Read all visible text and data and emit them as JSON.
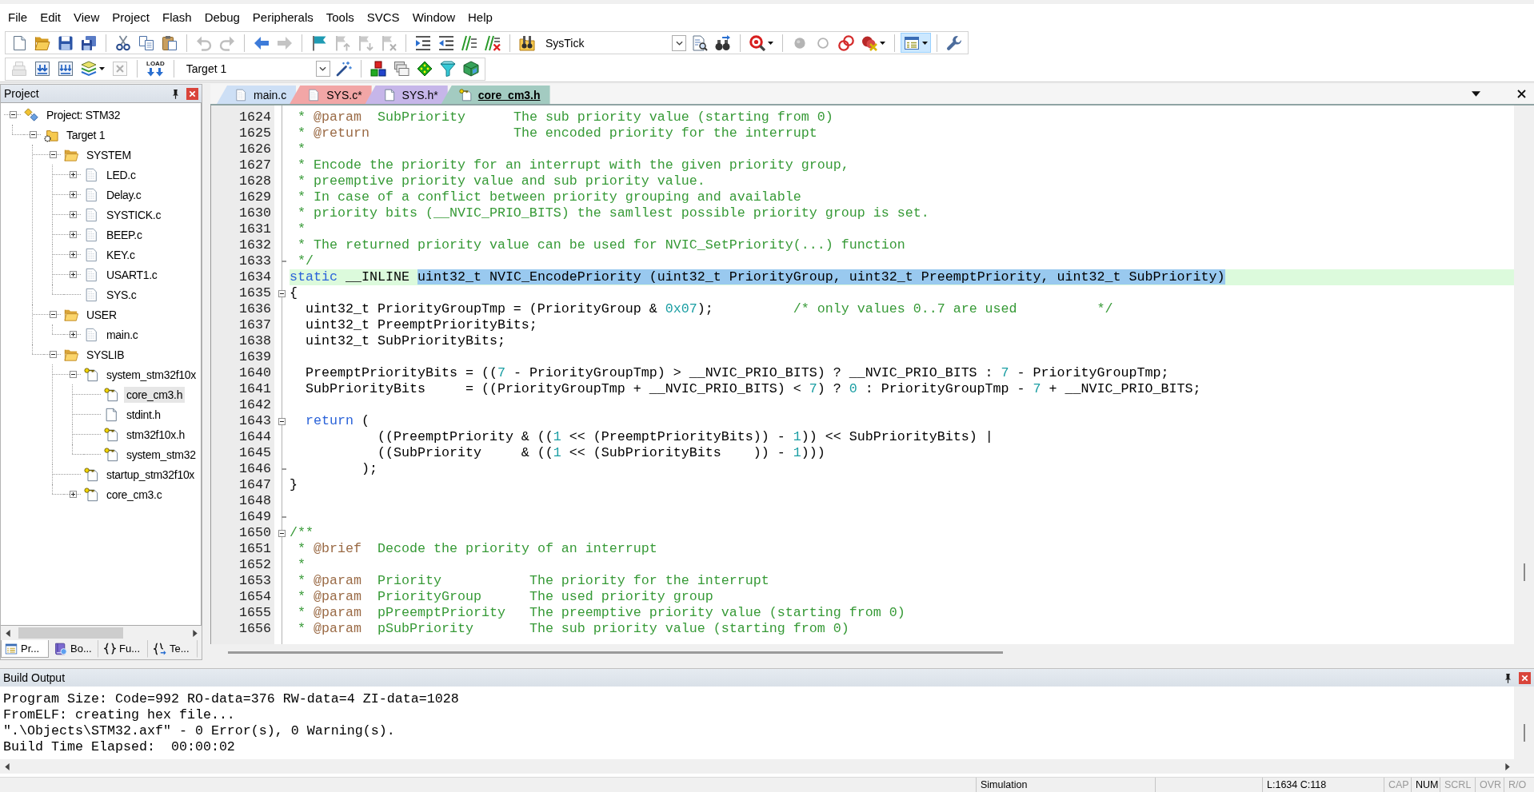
{
  "menu_bar": {
    "items": [
      "File",
      "Edit",
      "View",
      "Project",
      "Flash",
      "Debug",
      "Peripherals",
      "Tools",
      "SVCS",
      "Window",
      "Help"
    ]
  },
  "toolbars": [
    {
      "items": [
        {
          "kind": "button",
          "disabled": false,
          "pressed": false
        },
        {
          "kind": "button",
          "disabled": false,
          "pressed": false
        },
        {
          "kind": "button",
          "disabled": false,
          "pressed": false
        },
        {
          "kind": "button",
          "disabled": false,
          "pressed": false
        },
        {
          "kind": "separator"
        },
        {
          "kind": "button",
          "disabled": false,
          "pressed": false
        },
        {
          "kind": "button",
          "disabled": false,
          "pressed": false
        },
        {
          "kind": "button",
          "disabled": false,
          "pressed": false
        },
        {
          "kind": "separator"
        },
        {
          "kind": "button",
          "disabled": true,
          "pressed": false
        },
        {
          "kind": "button",
          "disabled": true,
          "pressed": false
        },
        {
          "kind": "separator"
        },
        {
          "kind": "button",
          "disabled": false,
          "pressed": false
        },
        {
          "kind": "button",
          "disabled": true,
          "pressed": false
        },
        {
          "kind": "separator"
        },
        {
          "kind": "button",
          "disabled": false,
          "pressed": false
        },
        {
          "kind": "button",
          "disabled": true,
          "pressed": false
        },
        {
          "kind": "button",
          "disabled": true,
          "pressed": false
        },
        {
          "kind": "button",
          "disabled": true,
          "pressed": false
        },
        {
          "kind": "separator"
        },
        {
          "kind": "button",
          "disabled": false,
          "pressed": false
        },
        {
          "kind": "button",
          "disabled": false,
          "pressed": false
        },
        {
          "kind": "button",
          "disabled": false,
          "pressed": false
        },
        {
          "kind": "button",
          "disabled": false,
          "pressed": false
        },
        {
          "kind": "separator"
        },
        {
          "kind": "button",
          "disabled": false,
          "pressed": false
        },
        {
          "kind": "combo",
          "value": "SysTick"
        },
        {
          "kind": "button",
          "disabled": false,
          "pressed": false
        },
        {
          "kind": "button",
          "disabled": false,
          "pressed": false
        },
        {
          "kind": "separator"
        },
        {
          "kind": "split_button",
          "disabled": false,
          "pressed": false
        },
        {
          "kind": "separator"
        },
        {
          "kind": "button",
          "disabled": true,
          "pressed": false
        },
        {
          "kind": "button",
          "disabled": true,
          "pressed": false
        },
        {
          "kind": "button",
          "disabled": false,
          "pressed": false
        },
        {
          "kind": "split_button",
          "disabled": false,
          "pressed": false
        },
        {
          "kind": "separator"
        },
        {
          "kind": "split_button",
          "disabled": false,
          "pressed": true
        },
        {
          "kind": "separator"
        },
        {
          "kind": "button",
          "disabled": false,
          "pressed": false
        }
      ]
    },
    {
      "items": [
        {
          "kind": "button",
          "disabled": true,
          "pressed": false
        },
        {
          "kind": "button",
          "disabled": false,
          "pressed": false
        },
        {
          "kind": "button",
          "disabled": false,
          "pressed": false
        },
        {
          "kind": "split_button",
          "disabled": false,
          "pressed": false
        },
        {
          "kind": "button",
          "disabled": true,
          "pressed": false
        },
        {
          "kind": "separator"
        },
        {
          "kind": "button",
          "label": "LOAD",
          "disabled": false,
          "pressed": false
        },
        {
          "kind": "separator"
        },
        {
          "kind": "combo",
          "value": "Target 1"
        },
        {
          "kind": "button",
          "disabled": false,
          "pressed": false
        },
        {
          "kind": "separator"
        },
        {
          "kind": "button",
          "disabled": false,
          "pressed": false
        },
        {
          "kind": "button",
          "disabled": false,
          "pressed": false
        },
        {
          "kind": "button",
          "disabled": false,
          "pressed": false
        },
        {
          "kind": "button",
          "disabled": false,
          "pressed": false
        },
        {
          "kind": "button",
          "disabled": false,
          "pressed": false
        }
      ]
    }
  ],
  "project_panel": {
    "title": "Project",
    "tree": [
      {
        "label": "Project: STM32",
        "kind": "project",
        "expanded": true,
        "selected": false,
        "children": [
          {
            "label": "Target 1",
            "kind": "target",
            "expanded": true,
            "selected": false,
            "children": [
              {
                "label": "SYSTEM",
                "kind": "group",
                "expanded": true,
                "selected": false,
                "children": [
                  {
                    "label": "LED.c",
                    "kind": "source",
                    "expanded": false,
                    "selected": false
                  },
                  {
                    "label": "Delay.c",
                    "kind": "source",
                    "expanded": false,
                    "selected": false
                  },
                  {
                    "label": "SYSTICK.c",
                    "kind": "source",
                    "expanded": false,
                    "selected": false
                  },
                  {
                    "label": "BEEP.c",
                    "kind": "source",
                    "expanded": false,
                    "selected": false
                  },
                  {
                    "label": "KEY.c",
                    "kind": "source",
                    "expanded": false,
                    "selected": false
                  },
                  {
                    "label": "USART1.c",
                    "kind": "source",
                    "expanded": false,
                    "selected": false
                  },
                  {
                    "label": "SYS.c",
                    "kind": "source",
                    "selected": false
                  }
                ]
              },
              {
                "label": "USER",
                "kind": "group",
                "expanded": true,
                "selected": false,
                "children": [
                  {
                    "label": "main.c",
                    "kind": "source",
                    "expanded": false,
                    "selected": false
                  }
                ]
              },
              {
                "label": "SYSLIB",
                "kind": "group",
                "expanded": true,
                "selected": false,
                "children": [
                  {
                    "label": "system_stm32f10x",
                    "kind": "locked",
                    "expanded": true,
                    "selected": false,
                    "children": [
                      {
                        "label": "core_cm3.h",
                        "kind": "locked",
                        "selected": true
                      },
                      {
                        "label": "stdint.h",
                        "kind": "header",
                        "selected": false
                      },
                      {
                        "label": "stm32f10x.h",
                        "kind": "locked",
                        "selected": false
                      },
                      {
                        "label": "system_stm32",
                        "kind": "locked",
                        "selected": false
                      }
                    ]
                  },
                  {
                    "label": "startup_stm32f10x",
                    "kind": "locked",
                    "selected": false
                  },
                  {
                    "label": "core_cm3.c",
                    "kind": "locked",
                    "expanded": false,
                    "selected": false
                  }
                ]
              }
            ]
          }
        ]
      }
    ],
    "tabs": [
      {
        "label": "Pr...",
        "selected": true
      },
      {
        "label": "Bo...",
        "selected": false
      },
      {
        "label": "Fu...",
        "selected": false
      },
      {
        "label": "Te...",
        "selected": false
      }
    ]
  },
  "editor": {
    "tabs": [
      {
        "label": "main.c",
        "kind": "source",
        "color": "#cddff5",
        "selected": false
      },
      {
        "label": "SYS.c*",
        "kind": "source",
        "color": "#f2a6a6",
        "selected": false
      },
      {
        "label": "SYS.h*",
        "kind": "header",
        "color": "#c6b6e9",
        "selected": false
      },
      {
        "label": "core_cm3.h",
        "kind": "locked",
        "color": "#a3cbc1",
        "selected": true
      }
    ],
    "lines": [
      {
        "number": "1624",
        "current": false,
        "segments": [
          {
            "kind": "comment",
            "text": " * "
          },
          {
            "kind": "doc_tag",
            "text": "@param"
          },
          {
            "kind": "comment",
            "text": "  SubPriority      The sub priority value (starting from 0)"
          }
        ]
      },
      {
        "number": "1625",
        "current": false,
        "segments": [
          {
            "kind": "comment",
            "text": " * "
          },
          {
            "kind": "doc_tag",
            "text": "@return"
          },
          {
            "kind": "comment",
            "text": "                  The encoded priority for the interrupt"
          }
        ]
      },
      {
        "number": "1626",
        "current": false,
        "segments": [
          {
            "kind": "comment",
            "text": " *"
          }
        ]
      },
      {
        "number": "1627",
        "current": false,
        "segments": [
          {
            "kind": "comment",
            "text": " * Encode the priority for an interrupt with the given priority group,"
          }
        ]
      },
      {
        "number": "1628",
        "current": false,
        "segments": [
          {
            "kind": "comment",
            "text": " * preemptive priority value and sub priority value."
          }
        ]
      },
      {
        "number": "1629",
        "current": false,
        "segments": [
          {
            "kind": "comment",
            "text": " * In case of a conflict between priority grouping and available"
          }
        ]
      },
      {
        "number": "1630",
        "current": false,
        "segments": [
          {
            "kind": "comment",
            "text": " * priority bits (__NVIC_PRIO_BITS) the samllest possible priority group is set."
          }
        ]
      },
      {
        "number": "1631",
        "current": false,
        "segments": [
          {
            "kind": "comment",
            "text": " *"
          }
        ]
      },
      {
        "number": "1632",
        "current": false,
        "segments": [
          {
            "kind": "comment",
            "text": " * The returned priority value can be used for NVIC_SetPriority(...) function"
          }
        ]
      },
      {
        "number": "1633",
        "current": false,
        "fold_end": true,
        "segments": [
          {
            "kind": "comment",
            "text": " */"
          }
        ]
      },
      {
        "number": "1634",
        "current": true,
        "segments": [
          {
            "kind": "keyword",
            "text": "static"
          },
          {
            "kind": "plain",
            "text": " __INLINE "
          },
          {
            "kind": "plain",
            "text": "uint32_t NVIC_EncodePriority (uint32_t PriorityGroup, uint32_t PreemptPriority, uint32_t SubPriority)",
            "selected": true
          }
        ]
      },
      {
        "number": "1635",
        "current": false,
        "fold_start": true,
        "segments": [
          {
            "kind": "plain",
            "text": "{"
          }
        ]
      },
      {
        "number": "1636",
        "current": false,
        "segments": [
          {
            "kind": "plain",
            "text": "  uint32_t PriorityGroupTmp = (PriorityGroup & "
          },
          {
            "kind": "number",
            "text": "0x07"
          },
          {
            "kind": "plain",
            "text": ");          "
          },
          {
            "kind": "comment",
            "text": "/* only values 0..7 are used          */"
          }
        ]
      },
      {
        "number": "1637",
        "current": false,
        "segments": [
          {
            "kind": "plain",
            "text": "  uint32_t PreemptPriorityBits;"
          }
        ]
      },
      {
        "number": "1638",
        "current": false,
        "segments": [
          {
            "kind": "plain",
            "text": "  uint32_t SubPriorityBits;"
          }
        ]
      },
      {
        "number": "1639",
        "current": false
      },
      {
        "number": "1640",
        "current": false,
        "segments": [
          {
            "kind": "plain",
            "text": "  PreemptPriorityBits = (("
          },
          {
            "kind": "number",
            "text": "7"
          },
          {
            "kind": "plain",
            "text": " - PriorityGroupTmp) > __NVIC_PRIO_BITS) ? __NVIC_PRIO_BITS : "
          },
          {
            "kind": "number",
            "text": "7"
          },
          {
            "kind": "plain",
            "text": " - PriorityGroupTmp;"
          }
        ]
      },
      {
        "number": "1641",
        "current": false,
        "segments": [
          {
            "kind": "plain",
            "text": "  SubPriorityBits     = ((PriorityGroupTmp + __NVIC_PRIO_BITS) < "
          },
          {
            "kind": "number",
            "text": "7"
          },
          {
            "kind": "plain",
            "text": ") ? "
          },
          {
            "kind": "number",
            "text": "0"
          },
          {
            "kind": "plain",
            "text": " : PriorityGroupTmp - "
          },
          {
            "kind": "number",
            "text": "7"
          },
          {
            "kind": "plain",
            "text": " + __NVIC_PRIO_BITS;"
          }
        ]
      },
      {
        "number": "1642",
        "current": false
      },
      {
        "number": "1643",
        "current": false,
        "fold_start": true,
        "segments": [
          {
            "kind": "keyword",
            "text": "  return"
          },
          {
            "kind": "plain",
            "text": " ("
          }
        ]
      },
      {
        "number": "1644",
        "current": false,
        "segments": [
          {
            "kind": "plain",
            "text": "           ((PreemptPriority & (("
          },
          {
            "kind": "number",
            "text": "1"
          },
          {
            "kind": "plain",
            "text": " << (PreemptPriorityBits)) - "
          },
          {
            "kind": "number",
            "text": "1"
          },
          {
            "kind": "plain",
            "text": ")) << SubPriorityBits) |"
          }
        ]
      },
      {
        "number": "1645",
        "current": false,
        "segments": [
          {
            "kind": "plain",
            "text": "           ((SubPriority     & (("
          },
          {
            "kind": "number",
            "text": "1"
          },
          {
            "kind": "plain",
            "text": " << (SubPriorityBits    )) - "
          },
          {
            "kind": "number",
            "text": "1"
          },
          {
            "kind": "plain",
            "text": ")))"
          }
        ]
      },
      {
        "number": "1646",
        "current": false,
        "fold_end": true,
        "segments": [
          {
            "kind": "plain",
            "text": "         );"
          }
        ]
      },
      {
        "number": "1647",
        "current": false,
        "segments": [
          {
            "kind": "plain",
            "text": "}"
          }
        ]
      },
      {
        "number": "1648",
        "current": false
      },
      {
        "number": "1649",
        "current": false,
        "fold_end": true
      },
      {
        "number": "1650",
        "current": false,
        "fold_start": true,
        "segments": [
          {
            "kind": "comment",
            "text": "/**"
          }
        ]
      },
      {
        "number": "1651",
        "current": false,
        "segments": [
          {
            "kind": "comment",
            "text": " * "
          },
          {
            "kind": "doc_tag",
            "text": "@brief"
          },
          {
            "kind": "comment",
            "text": "  Decode the priority of an interrupt"
          }
        ]
      },
      {
        "number": "1652",
        "current": false,
        "segments": [
          {
            "kind": "comment",
            "text": " *"
          }
        ]
      },
      {
        "number": "1653",
        "current": false,
        "segments": [
          {
            "kind": "comment",
            "text": " * "
          },
          {
            "kind": "doc_tag",
            "text": "@param"
          },
          {
            "kind": "comment",
            "text": "  Priority           The priority for the interrupt"
          }
        ]
      },
      {
        "number": "1654",
        "current": false,
        "segments": [
          {
            "kind": "comment",
            "text": " * "
          },
          {
            "kind": "doc_tag",
            "text": "@param"
          },
          {
            "kind": "comment",
            "text": "  PriorityGroup      The used priority group"
          }
        ]
      },
      {
        "number": "1655",
        "current": false,
        "segments": [
          {
            "kind": "comment",
            "text": " * "
          },
          {
            "kind": "doc_tag",
            "text": "@param"
          },
          {
            "kind": "comment",
            "text": "  pPreemptPriority   The preemptive priority value (starting from 0)"
          }
        ]
      },
      {
        "number": "1656",
        "current": false,
        "segments": [
          {
            "kind": "comment",
            "text": " * "
          },
          {
            "kind": "doc_tag",
            "text": "@param"
          },
          {
            "kind": "comment",
            "text": "  pSubPriority       The sub priority value (starting from 0)"
          }
        ]
      }
    ]
  },
  "build_output": {
    "title": "Build Output",
    "lines": [
      "Program Size: Code=992 RO-data=376 RW-data=4 ZI-data=1028",
      "FromELF: creating hex file...",
      "\".\\Objects\\STM32.axf\" - 0 Error(s), 0 Warning(s).",
      "Build Time Elapsed:  00:00:02"
    ]
  },
  "status_bar": {
    "mode": "Simulation",
    "position": "L:1634 C:118",
    "indicators": [
      {
        "label": "CAP",
        "on": false
      },
      {
        "label": "NUM",
        "on": true
      },
      {
        "label": "SCRL",
        "on": false
      },
      {
        "label": "OVR",
        "on": false
      },
      {
        "label": "R/O",
        "on": false
      }
    ]
  }
}
